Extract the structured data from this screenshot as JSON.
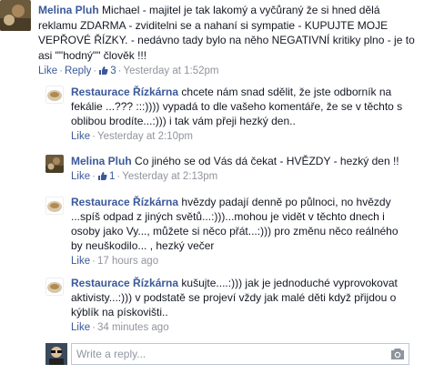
{
  "comments": [
    {
      "author": "Melina Pluh",
      "text": "Michael - majitel je tak lakomý a vyčůraný že si hned dělá reklamu ZDARMA - zviditelni se a nahaní si sympatie - KUPUJTE MOJE VEPŘOVÉ ŘÍZKY. - nedávno tady bylo na něho NEGATIVNÍ kritiky plno - je to asi \"\"hodný\"\" člověk !!!",
      "like_label": "Like",
      "reply_label": "Reply",
      "like_count": "3",
      "timestamp": "Yesterday at 1:52pm"
    },
    {
      "author": "Restaurace Řízkárna",
      "text": "chcete nám snad sdělit, že jste odborník na fekálie ...??? :::)))) vypadá to dle vašeho komentáře, že se v těchto s oblibou brodíte...:))) i tak vám přeji hezký den..",
      "like_label": "Like",
      "timestamp": "Yesterday at 2:10pm"
    },
    {
      "author": "Melina Pluh",
      "text": "Co jiného se od Vás dá čekat - HVĚZDY - hezký den !!",
      "like_label": "Like",
      "like_count": "1",
      "timestamp": "Yesterday at 2:13pm"
    },
    {
      "author": "Restaurace Řízkárna",
      "text": "hvězdy padají denně po půlnoci, no hvězdy ...spíš odpad z jiných světů...:)))...mohou je vidět v těchto dnech i osoby jako Vy..., můžete si něco přát...:))) pro změnu něco reálného by neuškodilo... , hezký večer",
      "like_label": "Like",
      "timestamp": "17 hours ago"
    },
    {
      "author": "Restaurace Řízkárna",
      "text": "kušujte....:))) jak je jednoduché vyprovokovat aktivisty...:))) v podstatě se projeví vždy jak malé děti když přijdou o kýblík na pískovišti..",
      "like_label": "Like",
      "timestamp": "34 minutes ago"
    }
  ],
  "reply_box": {
    "placeholder": "Write a reply..."
  },
  "colors": {
    "link": "#3b5998",
    "meta": "#90949c",
    "text": "#141823",
    "border": "#bdc7d8"
  },
  "icons": [
    "avatar-melina",
    "avatar-restaurant",
    "thumbs-up-icon",
    "camera-icon",
    "user-avatar"
  ]
}
